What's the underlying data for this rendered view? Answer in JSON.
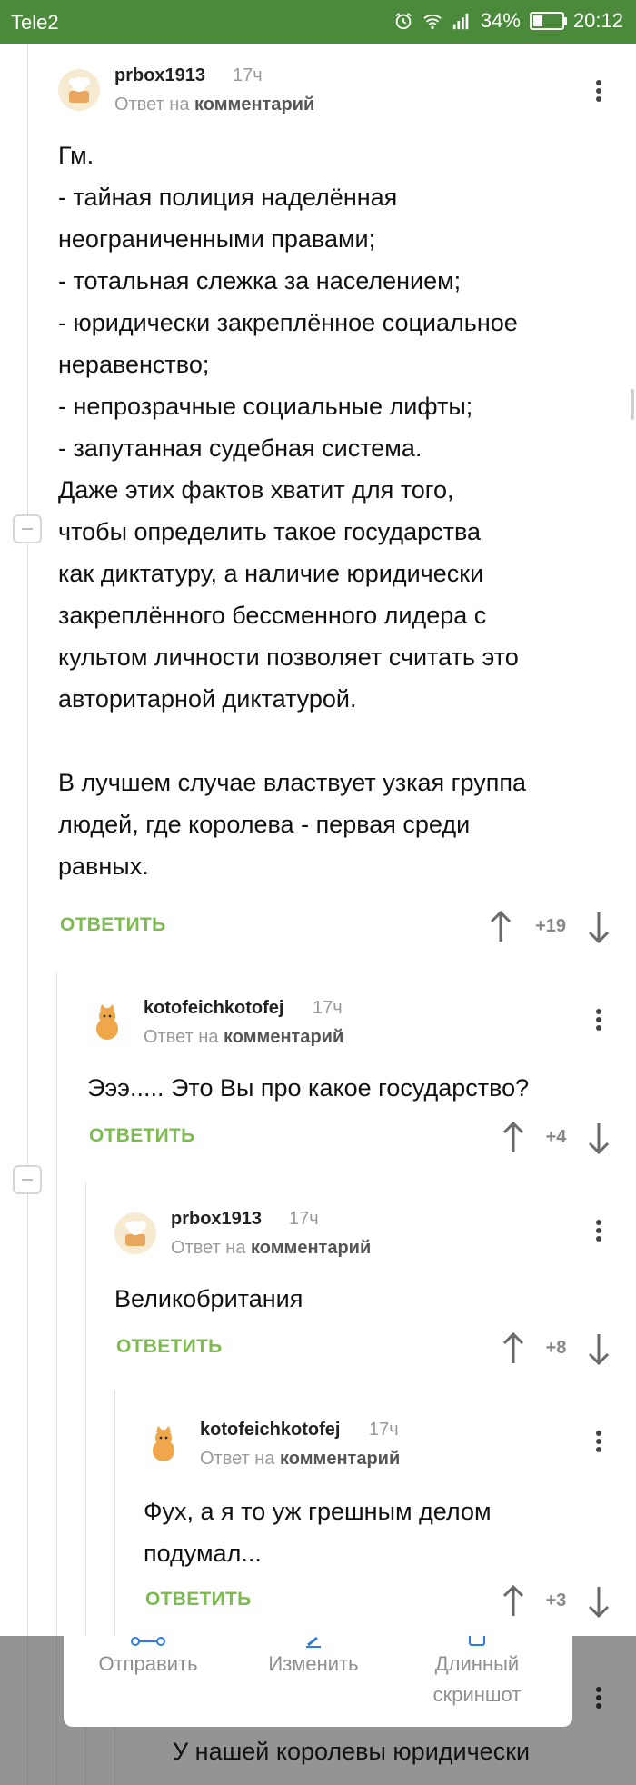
{
  "status_bar": {
    "carrier": "Tele2",
    "battery": "34%",
    "battery_level": 0.34,
    "time": "20:12",
    "icons": [
      "alarm-icon",
      "wifi-icon",
      "signal-icon",
      "battery-icon"
    ]
  },
  "comments": [
    {
      "author": "prbox1913",
      "time": "17ч",
      "reply_prefix": "Ответ на",
      "reply_target": "комментарий",
      "body": [
        "Гм.",
        "- тайная полиция наделённая",
        "неограниченными правами;",
        "- тотальная слежка за населением;",
        "- юридически закреплённое социальное",
        "неравенство;",
        "- непрозрачные социальные лифты;",
        "- запутанная судебная система.",
        "Даже этих фактов хватит для того,",
        "чтобы определить такое государства",
        "как диктатуру, а наличие юридически",
        "закреплённого бессменного лидера с",
        "культом личности позволяет считать это",
        "авторитарной диктатурой.",
        "",
        "В лучшем случае властвует узкая группа",
        "людей, где королева - первая среди",
        "равных."
      ],
      "reply_label": "ОТВЕТИТЬ",
      "score": "+19"
    },
    {
      "author": "kotofeichkotofej",
      "time": "17ч",
      "reply_prefix": "Ответ на",
      "reply_target": "комментарий",
      "body": [
        "Эээ..... Это Вы про какое государство?"
      ],
      "reply_label": "ОТВЕТИТЬ",
      "score": "+4"
    },
    {
      "author": "prbox1913",
      "time": "17ч",
      "reply_prefix": "Ответ на",
      "reply_target": "комментарий",
      "body": [
        "Великобритания"
      ],
      "reply_label": "ОТВЕТИТЬ",
      "score": "+8"
    },
    {
      "author": "kotofeichkotofej",
      "time": "17ч",
      "reply_prefix": "Ответ на",
      "reply_target": "комментарий",
      "body": [
        "Фух, а я то уж грешным делом",
        "подумал..."
      ],
      "reply_label": "ОТВЕТИТЬ",
      "score": "+3"
    }
  ],
  "share_panel": {
    "items": [
      {
        "label": "Отправить",
        "icon": "send-icon"
      },
      {
        "label": "Изменить",
        "icon": "edit-icon"
      },
      {
        "label": "Длинный скриншот",
        "line1": "Длинный",
        "line2": "скриншот",
        "icon": "long-screenshot-icon"
      }
    ]
  },
  "next_comment_preview": "У нашей королевы юридически",
  "colors": {
    "status_bar": "#4a8a3a",
    "reply_green": "#7dbb4f",
    "muted": "#9a9a9a"
  }
}
